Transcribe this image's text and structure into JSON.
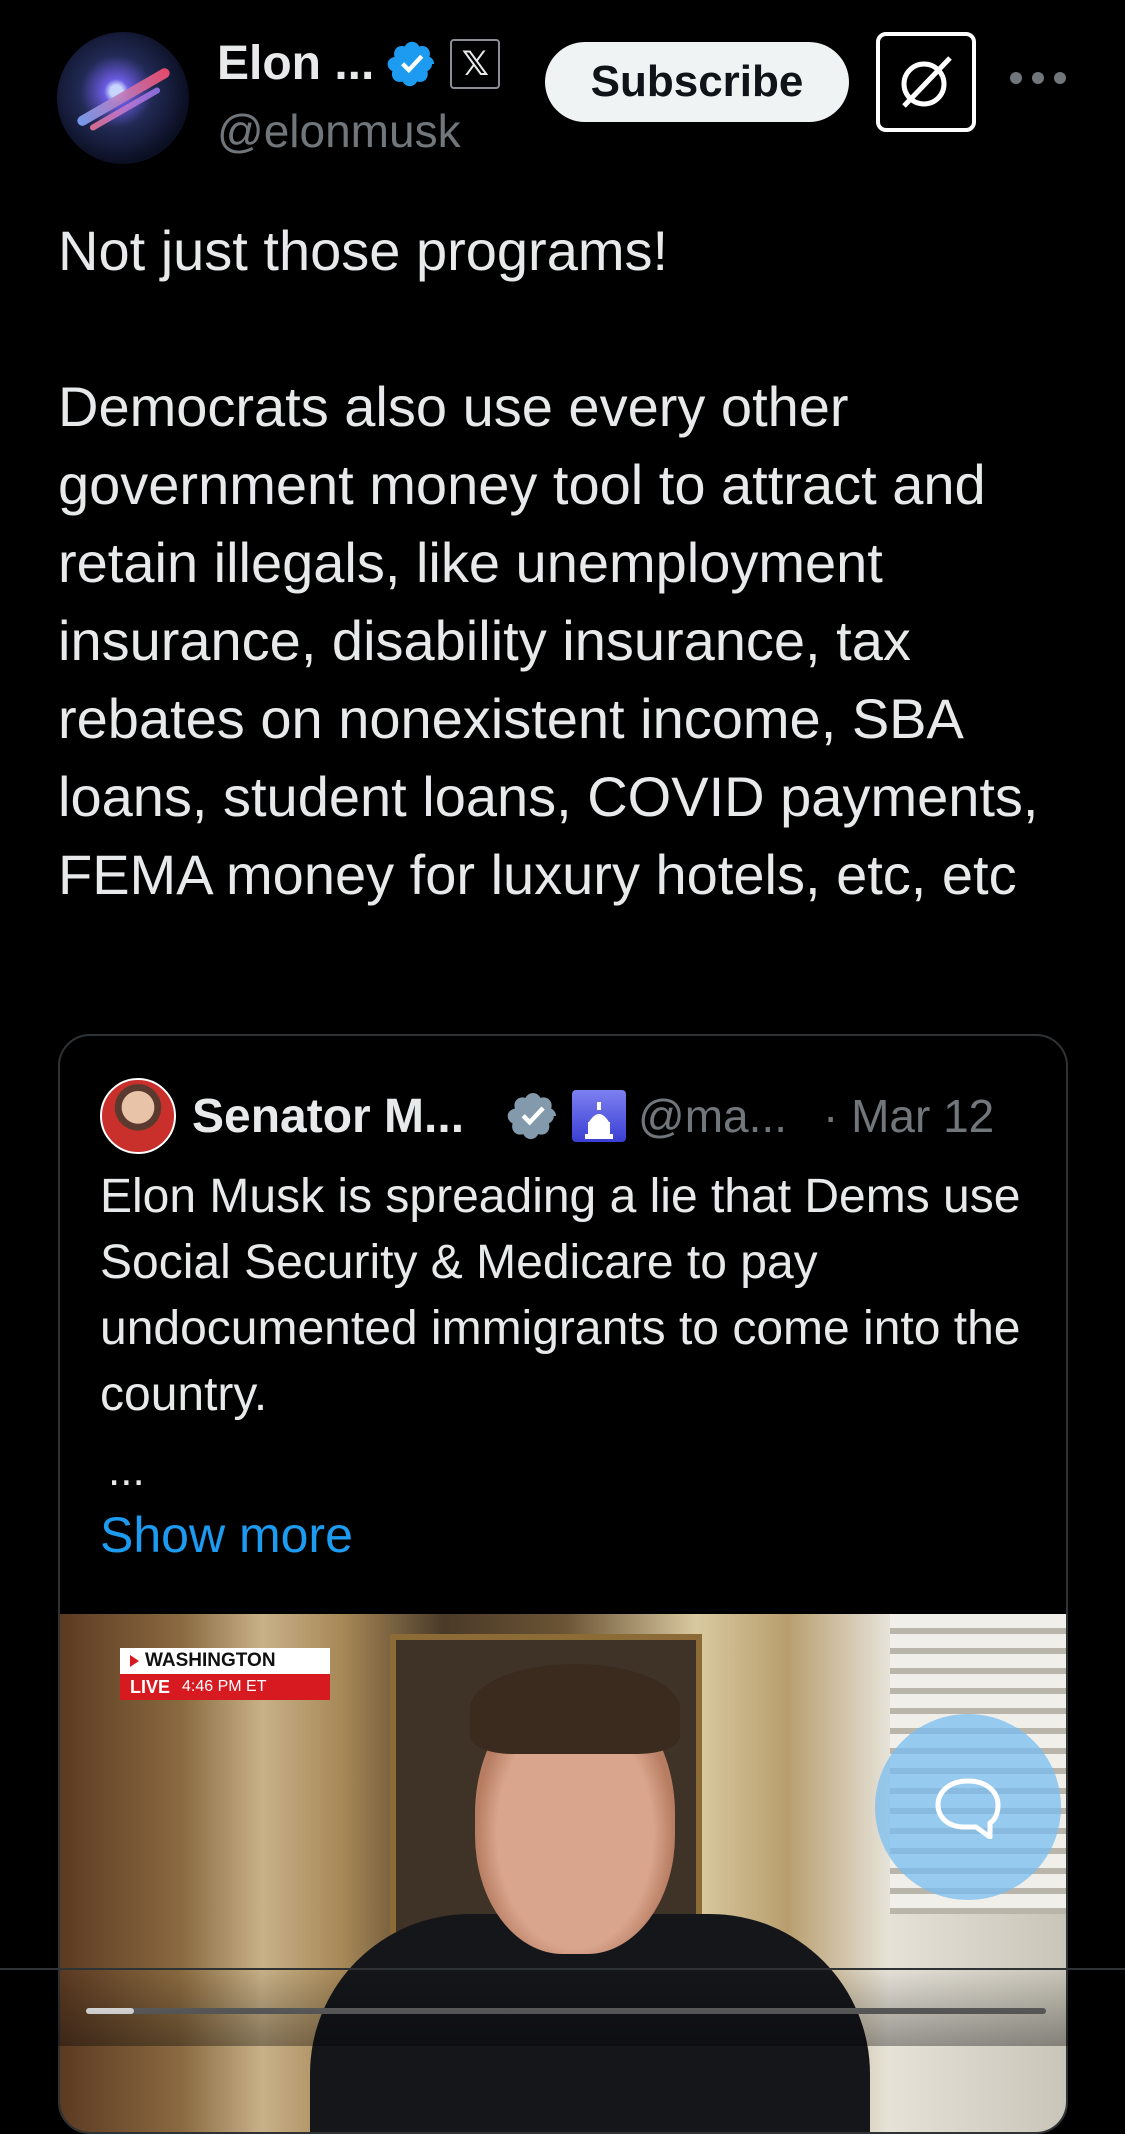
{
  "post": {
    "author_name": "Elon ...",
    "author_handle": "@elonmusk",
    "subscribe_label": "Subscribe",
    "badge_x": "𝕏",
    "text": "Not just those programs!\n\nDemocrats also use every other government money tool to attract and retain illegals, like unemployment insurance, disability insurance, tax rebates on nonexistent income, SBA loans, student loans, COVID payments, FEMA money for luxury hotels, etc, etc"
  },
  "quote": {
    "author_name": "Senator M...",
    "author_handle": "@ma...",
    "date": "· Mar 12",
    "text": "Elon Musk is spreading a lie that Dems use Social Security & Medicare to pay undocumented immigrants to come into the country.",
    "ellipsis": "...",
    "show_more": "Show more",
    "video": {
      "overlay_location": "WASHINGTON",
      "overlay_live": "LIVE",
      "overlay_time": "4:46 PM ET",
      "progress": 0.05
    }
  },
  "colors": {
    "accent": "#1d9bf0",
    "background": "#000000",
    "text": "#e7e9ea",
    "muted": "#71767b",
    "live_red": "#d71920"
  },
  "icons": {
    "verified": "verified-badge-icon",
    "x_badge": "x-logo-icon",
    "grok": "grok-icon",
    "more": "more-options-icon",
    "reply": "reply-icon"
  }
}
